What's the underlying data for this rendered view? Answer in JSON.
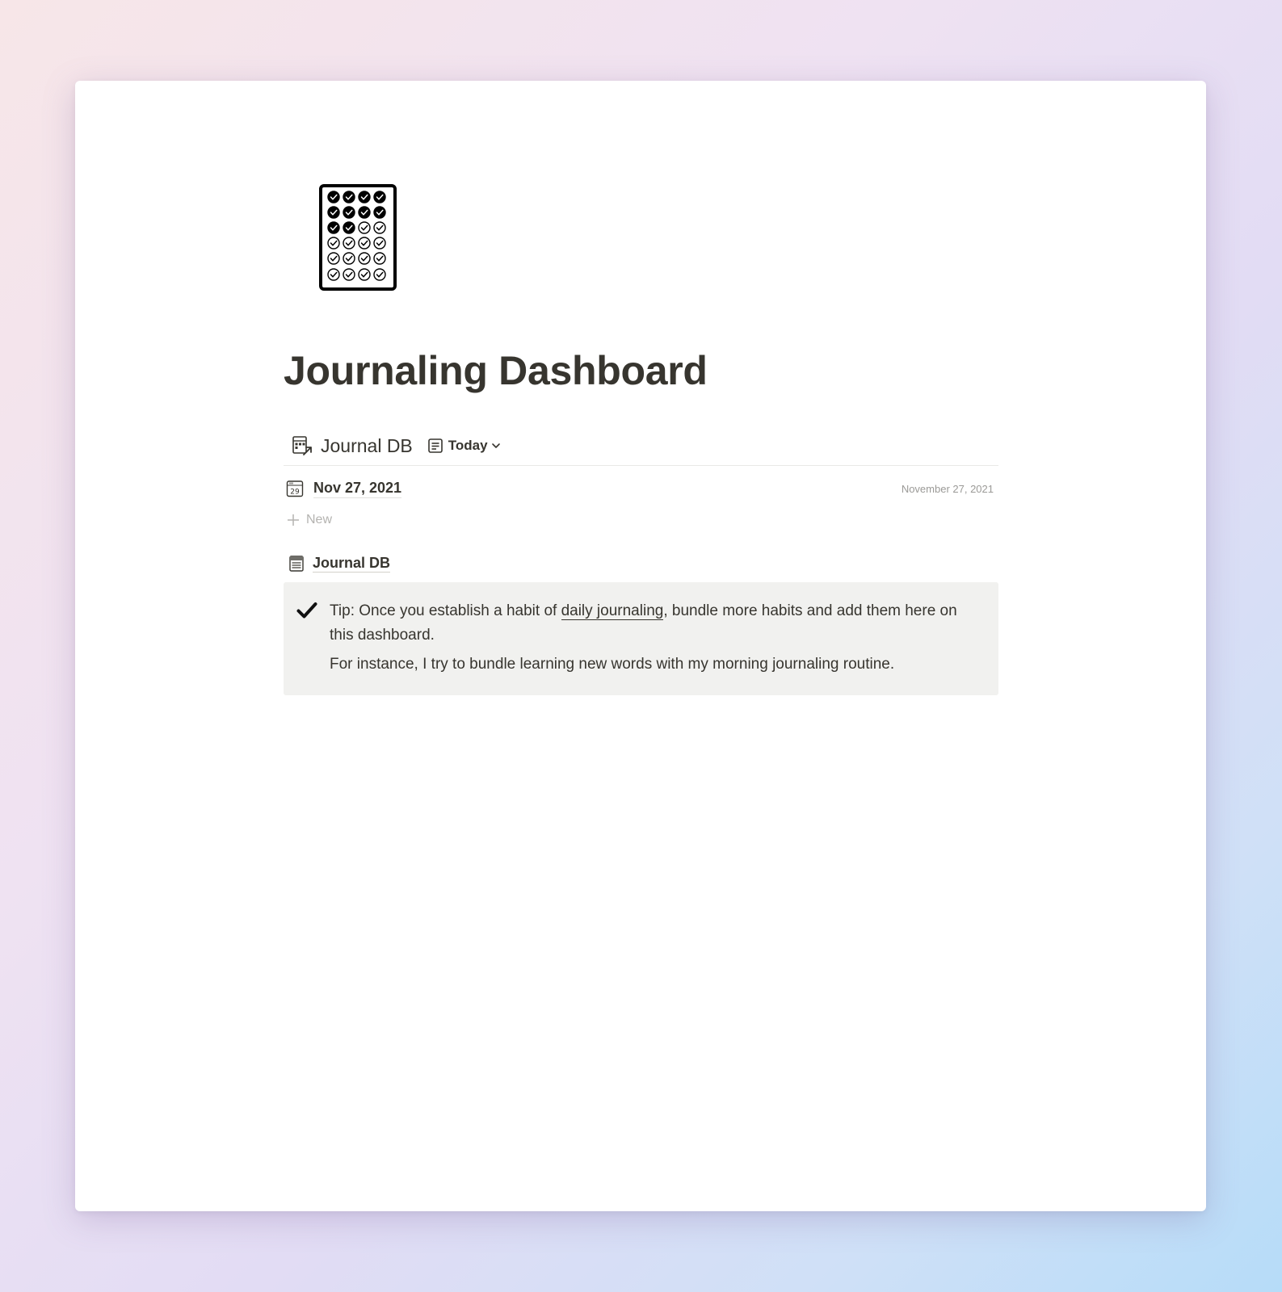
{
  "page": {
    "title": "Journaling Dashboard",
    "icon": "habit-tracker-grid-icon"
  },
  "linked_db": {
    "icon": "linked-database-icon",
    "title": "Journal DB",
    "view": {
      "icon": "list-view-icon",
      "label": "Today"
    },
    "entries": [
      {
        "icon": "calendar-icon",
        "title": "Nov 27, 2021",
        "date": "November 27, 2021"
      }
    ],
    "new_label": "New"
  },
  "page_link": {
    "icon": "database-page-icon",
    "label": "Journal DB"
  },
  "callout": {
    "icon": "checkmark-icon",
    "line1_prefix": "Tip: Once you establish a habit of ",
    "line1_link": "daily journaling",
    "line1_suffix": ", bundle more habits and add them here on this dashboard.",
    "line2": "For instance, I try to bundle learning new words with my morning journaling routine."
  },
  "colors": {
    "text": "#37352f",
    "muted": "#9b9a97",
    "callout_bg": "#f1f1ef"
  }
}
